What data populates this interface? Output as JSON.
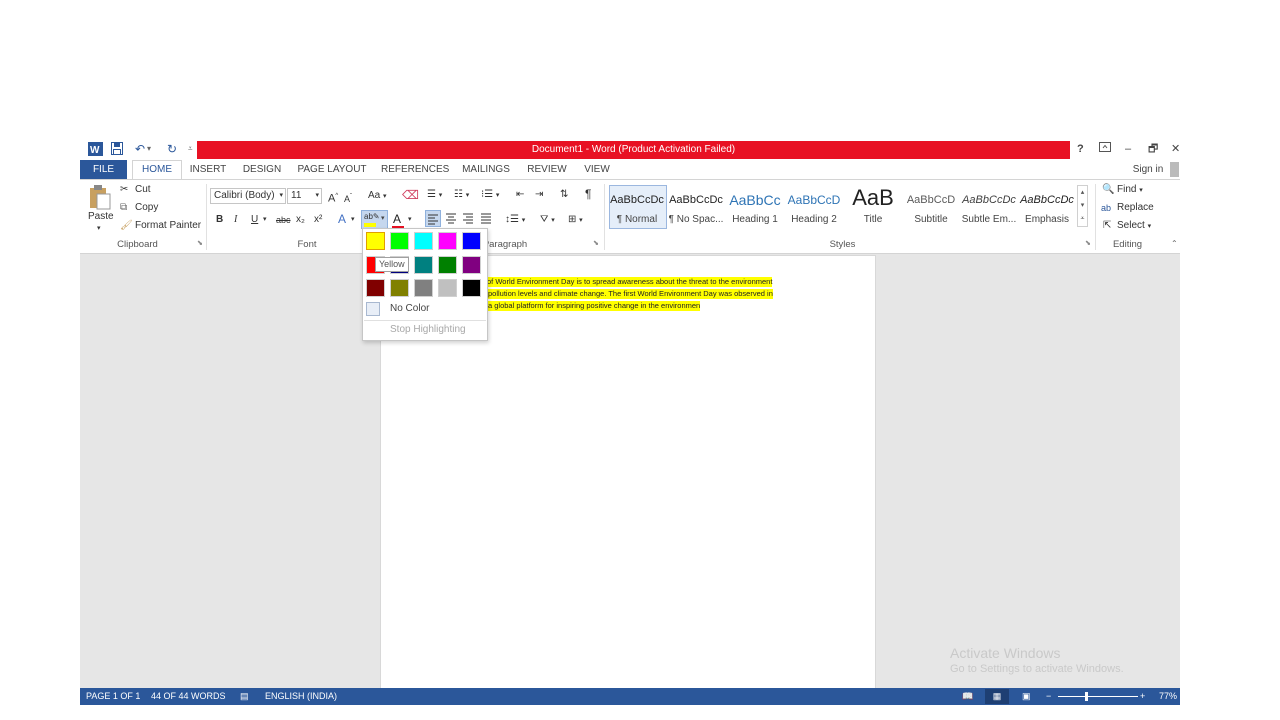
{
  "window": {
    "title": "Document1  -  Word (Product Activation Failed)",
    "help": "?",
    "minimize": "–",
    "restore": "🗗",
    "close": "✕"
  },
  "tabs": [
    "FILE",
    "HOME",
    "INSERT",
    "DESIGN",
    "PAGE LAYOUT",
    "REFERENCES",
    "MAILINGS",
    "REVIEW",
    "VIEW"
  ],
  "sign_in": "Sign in",
  "clipboard": {
    "paste": "Paste",
    "cut": "Cut",
    "copy": "Copy",
    "format_painter": "Format Painter",
    "label": "Clipboard"
  },
  "font": {
    "name": "Calibri (Body)",
    "size": "11",
    "bold": "B",
    "italic": "I",
    "underline": "U",
    "strike": "abc",
    "subscript": "x₂",
    "superscript": "x²",
    "grow": "A",
    "shrink": "A",
    "change_case": "Aa",
    "label": "Font"
  },
  "paragraph": {
    "label": "Paragraph"
  },
  "styles": {
    "items": [
      {
        "preview": "AaBbCcDc",
        "name": "¶ Normal"
      },
      {
        "preview": "AaBbCcDc",
        "name": "¶ No Spac..."
      },
      {
        "preview": "AaBbCc",
        "name": "Heading 1"
      },
      {
        "preview": "AaBbCcD",
        "name": "Heading 2"
      },
      {
        "preview": "AaB",
        "name": "Title"
      },
      {
        "preview": "AaBbCcD",
        "name": "Subtitle"
      },
      {
        "preview": "AaBbCcDc",
        "name": "Subtle Em..."
      },
      {
        "preview": "AaBbCcDc",
        "name": "Emphasis"
      }
    ],
    "label": "Styles"
  },
  "editing": {
    "find": "Find",
    "replace": "Replace",
    "select": "Select",
    "label": "Editing"
  },
  "highlight_menu": {
    "tooltip": "Yellow",
    "colors": [
      "#ffff00",
      "#00ff00",
      "#00ffff",
      "#ff00ff",
      "#0000ff",
      "#ff0000",
      "#000080",
      "#008080",
      "#008000",
      "#800080",
      "#800000",
      "#808000",
      "#808080",
      "#c0c0c0",
      "#000000"
    ],
    "no_color": "No Color",
    "stop": "Stop Highlighting"
  },
  "document": {
    "lines": [
      "of World Environment Day is to spread awareness about the threat to the environment",
      "pollution levels and climate change. The first World Environment Day was observed in",
      "a global platform for inspiring positive change in the environmen"
    ]
  },
  "status": {
    "page": "PAGE 1 OF 1",
    "words": "44 OF 44 WORDS",
    "language": "ENGLISH (INDIA)",
    "zoom": "77%"
  },
  "watermark": {
    "title": "Activate Windows",
    "subtitle": "Go to Settings to activate Windows."
  }
}
